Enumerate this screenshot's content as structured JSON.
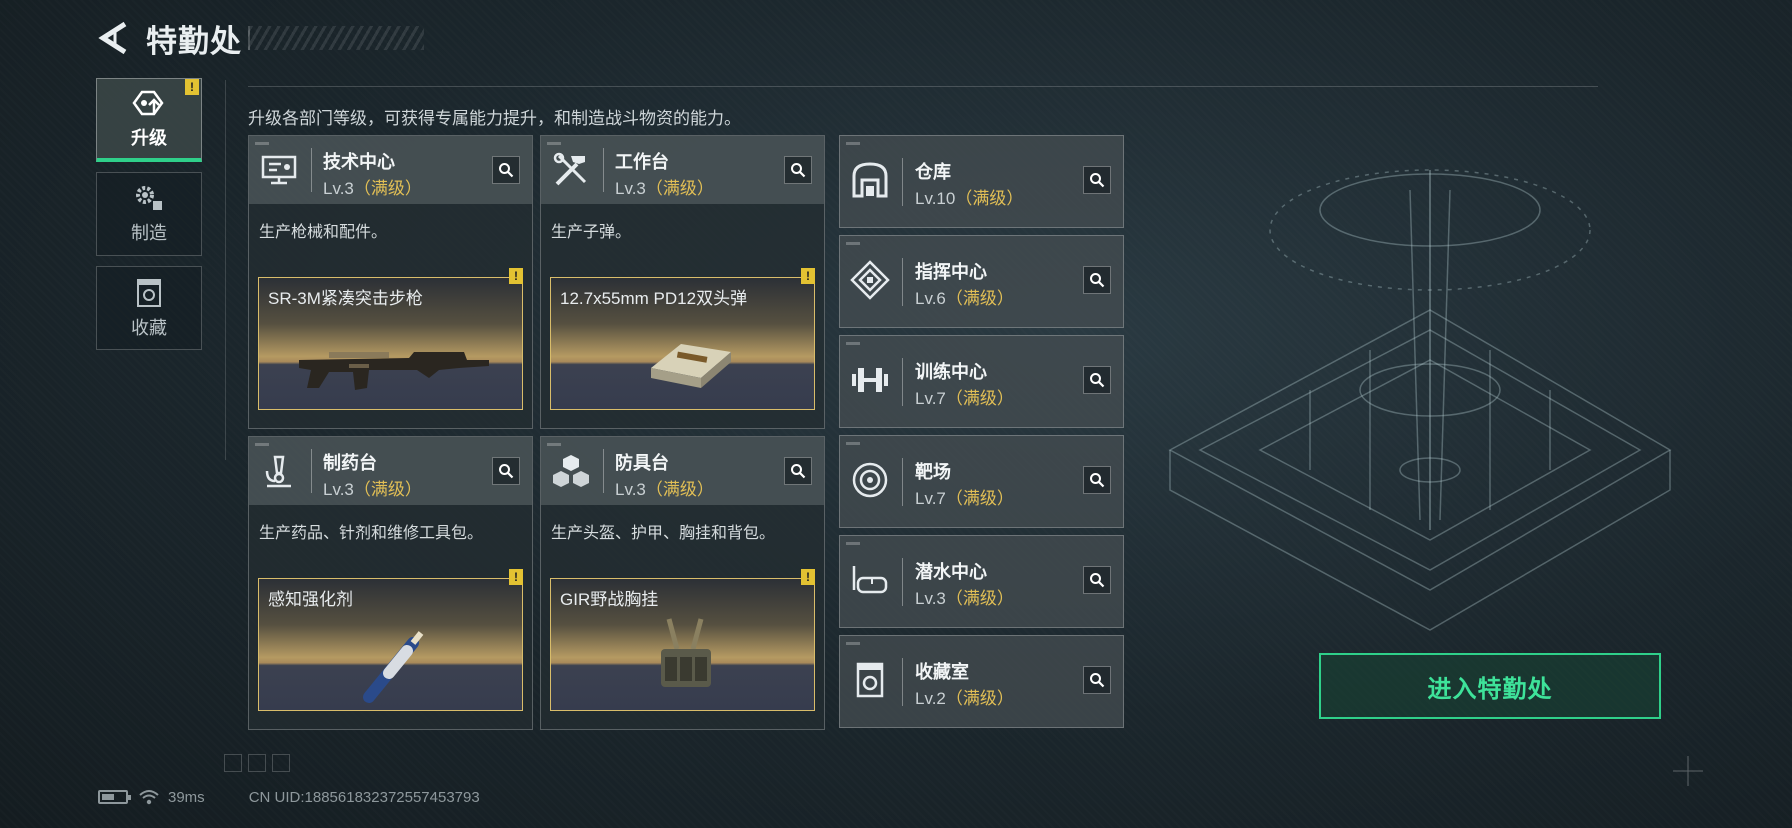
{
  "header": {
    "title": "特勤处"
  },
  "nav": {
    "items": [
      {
        "label": "升级",
        "icon": "upgrade-icon",
        "active": true,
        "badge": "!"
      },
      {
        "label": "制造",
        "icon": "gears-icon",
        "active": false
      },
      {
        "label": "收藏",
        "icon": "collection-icon",
        "active": false
      }
    ]
  },
  "intro": "升级各部门等级，可获得专属能力提升，和制造战斗物资的能力。",
  "cards": [
    {
      "name": "技术中心",
      "level": "Lv.3",
      "max": "（满级）",
      "desc": "生产枪械和配件。",
      "product": "SR-3M紧凑突击步枪",
      "badge": "!",
      "icon": "computer-icon"
    },
    {
      "name": "工作台",
      "level": "Lv.3",
      "max": "（满级）",
      "desc": "生产子弹。",
      "product": "12.7x55mm PD12双头弹",
      "badge": "!",
      "icon": "tools-icon"
    },
    {
      "name": "制药台",
      "level": "Lv.3",
      "max": "（满级）",
      "desc": "生产药品、针剂和维修工具包。",
      "product": "感知强化剂",
      "badge": "!",
      "icon": "microscope-icon"
    },
    {
      "name": "防具台",
      "level": "Lv.3",
      "max": "（满级）",
      "desc": "生产头盔、护甲、胸挂和背包。",
      "product": "GIR野战胸挂",
      "badge": "!",
      "icon": "cubes-icon"
    }
  ],
  "departments": [
    {
      "name": "仓库",
      "level": "Lv.10",
      "max": "（满级）",
      "icon": "warehouse-icon"
    },
    {
      "name": "指挥中心",
      "level": "Lv.6",
      "max": "（满级）",
      "icon": "command-icon"
    },
    {
      "name": "训练中心",
      "level": "Lv.7",
      "max": "（满级）",
      "icon": "dumbbell-icon"
    },
    {
      "name": "靶场",
      "level": "Lv.7",
      "max": "（满级）",
      "icon": "target-icon"
    },
    {
      "name": "潜水中心",
      "level": "Lv.3",
      "max": "（满级）",
      "icon": "diving-mask-icon"
    },
    {
      "name": "收藏室",
      "level": "Lv.2",
      "max": "（满级）",
      "icon": "collection-icon"
    }
  ],
  "enter_button": "进入特勤处",
  "footer": {
    "ping": "39ms",
    "uid": "CN UID:1885618323725574537​93",
    "battery_level": 0.55
  },
  "colors": {
    "accent": "#2fd08a",
    "max_level": "#e2bf55",
    "badge": "#e3c232"
  }
}
